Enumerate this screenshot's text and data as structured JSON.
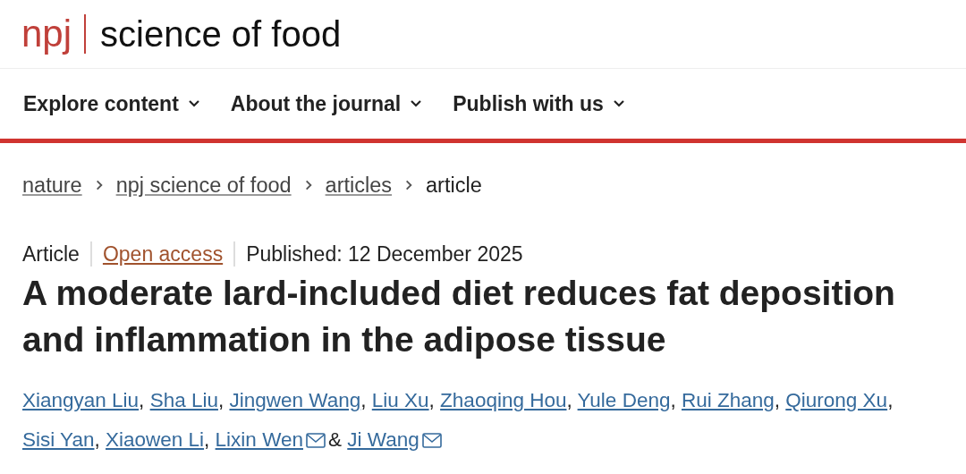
{
  "header": {
    "logo_mark": "npj",
    "journal": "science of food"
  },
  "nav": [
    {
      "label": "Explore content"
    },
    {
      "label": "About the journal"
    },
    {
      "label": "Publish with us"
    }
  ],
  "breadcrumb": [
    {
      "label": "nature",
      "link": true
    },
    {
      "label": "npj science of food",
      "link": true
    },
    {
      "label": "articles",
      "link": true
    },
    {
      "label": "article",
      "link": false
    }
  ],
  "meta": {
    "type": "Article",
    "access": "Open access",
    "published": "Published: 12 December 2025"
  },
  "title": "A moderate lard-included diet reduces fat deposition and inflammation in the adipose tissue",
  "authors": [
    {
      "name": "Xiangyan Liu",
      "corresponding": false,
      "sep": ","
    },
    {
      "name": "Sha Liu",
      "corresponding": false,
      "sep": ","
    },
    {
      "name": "Jingwen Wang",
      "corresponding": false,
      "sep": ","
    },
    {
      "name": "Liu Xu",
      "corresponding": false,
      "sep": ","
    },
    {
      "name": "Zhaoqing Hou",
      "corresponding": false,
      "sep": ","
    },
    {
      "name": "Yule Deng",
      "corresponding": false,
      "sep": ","
    },
    {
      "name": "Rui Zhang",
      "corresponding": false,
      "sep": ","
    },
    {
      "name": "Qiurong Xu",
      "corresponding": false,
      "sep": ","
    },
    {
      "name": "Sisi Yan",
      "corresponding": false,
      "sep": ","
    },
    {
      "name": "Xiaowen Li",
      "corresponding": false,
      "sep": ","
    },
    {
      "name": "Lixin Wen",
      "corresponding": true,
      "sep": "&"
    },
    {
      "name": "Ji Wang",
      "corresponding": true
    }
  ]
}
